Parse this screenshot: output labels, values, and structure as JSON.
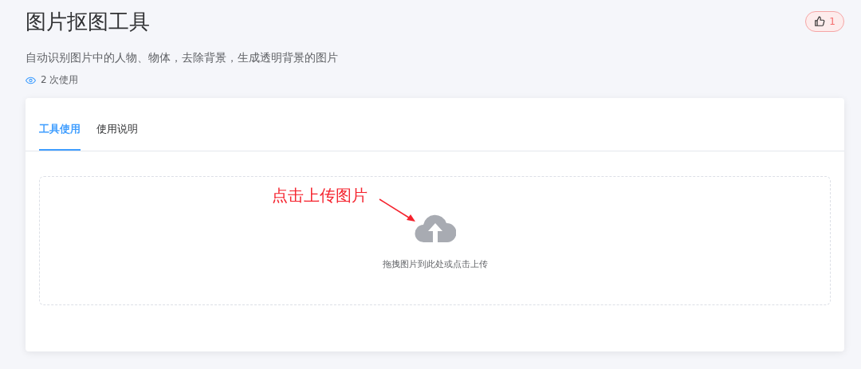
{
  "header": {
    "title": "图片抠图工具",
    "like_count": "1",
    "description": "自动识别图片中的人物、物体，去除背景，生成透明背景的图片",
    "usage": "2 次使用"
  },
  "tabs": [
    {
      "label": "工具使用",
      "selected": true
    },
    {
      "label": "使用说明",
      "selected": false
    }
  ],
  "upload": {
    "hint": "拖拽图片到此处或点击上传",
    "annotation": "点击上传图片"
  }
}
